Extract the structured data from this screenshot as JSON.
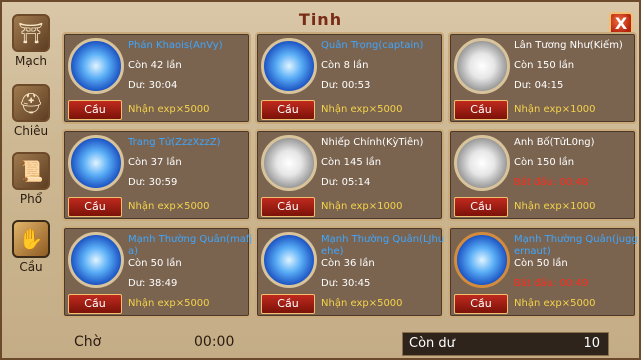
{
  "title": "Tinh",
  "close_label": "X",
  "sidebar": [
    {
      "label": "Mạch",
      "icon": "pagoda-icon"
    },
    {
      "label": "Chiêu",
      "icon": "helmet-icon"
    },
    {
      "label": "Phổ",
      "icon": "scroll-icon"
    },
    {
      "label": "Cầu",
      "icon": "hand-icon",
      "active": true
    }
  ],
  "cards": [
    {
      "name": "Phán Khaois(AnVy)",
      "line1": "Còn 42 lần",
      "line2": "Dư: 30:04",
      "exp": "Nhận exp×5000",
      "button": "Cầu",
      "orb": "blue"
    },
    {
      "name": "Quân Trọng(captain)",
      "line1": "Còn 8 lần",
      "line2": "Dư: 00:53",
      "exp": "Nhận exp×5000",
      "button": "Cầu",
      "orb": "blue"
    },
    {
      "name": "Lân Tương Như(Kiếm)",
      "line1": "Còn 150 lần",
      "line2": "Dư: 04:15",
      "exp": "Nhận exp×1000",
      "button": "Cầu",
      "orb": "white",
      "plain": true
    },
    {
      "name": "Trang Tử(ZzzXzzZ)",
      "line1": "Còn 37 lần",
      "line2": "Dư: 30:59",
      "exp": "Nhận exp×5000",
      "button": "Cầu",
      "orb": "blue"
    },
    {
      "name": "Nhiếp Chính(KỳTiên)",
      "line1": "Còn 145 lần",
      "line2": "Dư: 05:14",
      "exp": "Nhận exp×1000",
      "button": "Cầu",
      "orb": "white",
      "plain": true
    },
    {
      "name": "Anh Bố(TửL0ng)",
      "line1": "Còn 150 lần",
      "line2": "Bắt đầu: 00:48",
      "exp": "Nhận exp×1000",
      "button": "Cầu",
      "orb": "white",
      "plain": true,
      "red2": true
    },
    {
      "name": "Mạnh Thường Quân(mafj",
      "name2": "a)",
      "line1": "Còn 50 lần",
      "line2": "Dư: 38:49",
      "exp": "Nhận exp×5000",
      "button": "Cầu",
      "orb": "blue"
    },
    {
      "name": "Mạnh Thường Quân(LJhu",
      "name2": "ehe)",
      "line1": "Còn 36 lần",
      "line2": "Dư: 30:45",
      "exp": "Nhận exp×5000",
      "button": "Cầu",
      "orb": "blue"
    },
    {
      "name": "Mạnh Thường Quân(jugg",
      "name2": "ernaut)",
      "line1": "Còn 50 lần",
      "line2": "Bắt đầu: 00:49",
      "exp": "Nhận exp×5000",
      "button": "Cầu",
      "orb": "blue",
      "orange": true,
      "red2": true
    }
  ],
  "wait": {
    "label": "Chờ",
    "value": "00:00"
  },
  "remain": {
    "label": "Còn dư",
    "value": "10"
  }
}
